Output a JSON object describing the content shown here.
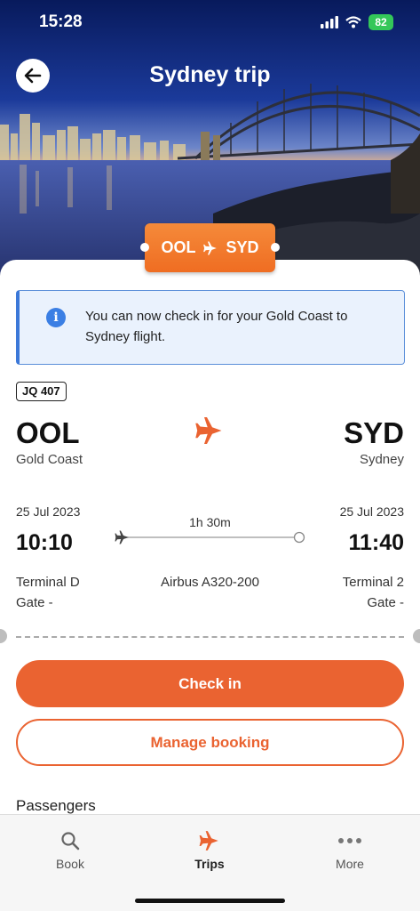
{
  "status_bar": {
    "time": "15:28",
    "battery": "82"
  },
  "header": {
    "title": "Sydney trip",
    "route_tag": {
      "origin": "OOL",
      "destination": "SYD"
    }
  },
  "info_banner": {
    "text": "You can now check in for your Gold Coast to Sydney flight."
  },
  "flight": {
    "number": "JQ 407",
    "origin": {
      "code": "OOL",
      "city": "Gold Coast",
      "date": "25 Jul 2023",
      "time": "10:10",
      "terminal": "Terminal D",
      "gate": "Gate -"
    },
    "destination": {
      "code": "SYD",
      "city": "Sydney",
      "date": "25 Jul 2023",
      "time": "11:40",
      "terminal": "Terminal 2",
      "gate": "Gate -"
    },
    "duration": "1h 30m",
    "aircraft": "Airbus A320-200"
  },
  "actions": {
    "check_in": "Check in",
    "manage_booking": "Manage booking"
  },
  "sections": {
    "passengers": "Passengers"
  },
  "tabbar": {
    "book": "Book",
    "trips": "Trips",
    "more": "More"
  },
  "colors": {
    "accent": "#ea6331",
    "info": "#3b7fe4",
    "battery": "#34c759"
  }
}
